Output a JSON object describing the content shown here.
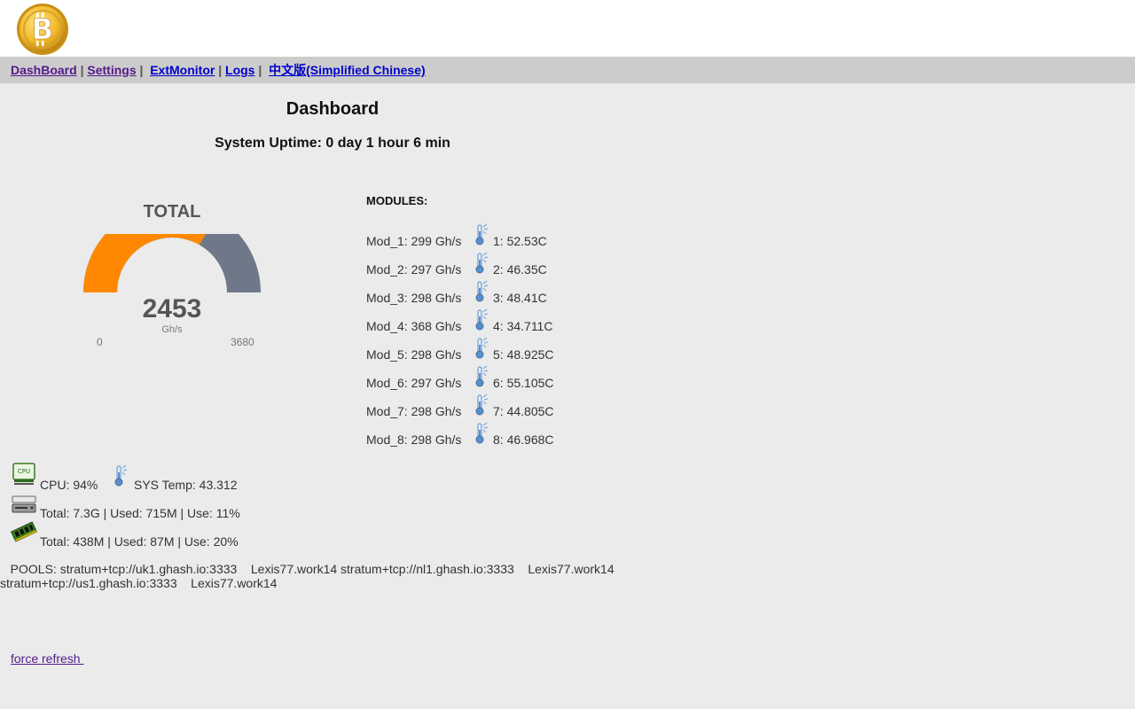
{
  "nav": {
    "items": [
      {
        "label": "DashBoard"
      },
      {
        "label": "Settings"
      },
      {
        "label": "ExtMonitor"
      },
      {
        "label": "Logs"
      },
      {
        "label": "中文版(Simplified Chinese)"
      }
    ],
    "separator": "|"
  },
  "page": {
    "title": "Dashboard",
    "uptime": "System Uptime: 0 day 1 hour 6 min"
  },
  "gauge": {
    "label": "TOTAL",
    "value": 2453,
    "value_text": "2453",
    "unit": "Gh/s",
    "min": 0,
    "min_text": "0",
    "max": 3680,
    "max_text": "3680",
    "colors": {
      "fill": "#ff8800",
      "track": "#6e7888"
    }
  },
  "modules": {
    "title": "MODULES:",
    "items": [
      {
        "name": "Mod_1: 299 Gh/s",
        "temp": "1: 52.53C"
      },
      {
        "name": "Mod_2: 297 Gh/s",
        "temp": "2: 46.35C"
      },
      {
        "name": "Mod_3: 298 Gh/s",
        "temp": "3: 48.41C"
      },
      {
        "name": "Mod_4: 368 Gh/s",
        "temp": "4: 34.711C"
      },
      {
        "name": "Mod_5: 298 Gh/s",
        "temp": "5: 48.925C"
      },
      {
        "name": "Mod_6: 297 Gh/s",
        "temp": "6: 55.105C"
      },
      {
        "name": "Mod_7: 298 Gh/s",
        "temp": "7: 44.805C"
      },
      {
        "name": "Mod_8: 298 Gh/s",
        "temp": "8: 46.968C"
      }
    ]
  },
  "system": {
    "cpu": "CPU: 94%",
    "sys_temp": "SYS Temp: 43.312",
    "disk": "Total: 7.3G | Used: 715M | Use: 11%",
    "memory": "Total: 438M | Used: 87M | Use: 20%",
    "icons": {
      "cpu": "cpu-icon",
      "disk": "disk-icon",
      "memory": "memory-icon",
      "temp": "thermometer-icon"
    }
  },
  "pools": {
    "text": "   POOLS: stratum+tcp://uk1.ghash.io:3333    Lexis77.work14 stratum+tcp://nl1.ghash.io:3333    Lexis77.work14 stratum+tcp://us1.ghash.io:3333    Lexis77.work14"
  },
  "footer": {
    "refresh_label": "force refresh "
  }
}
